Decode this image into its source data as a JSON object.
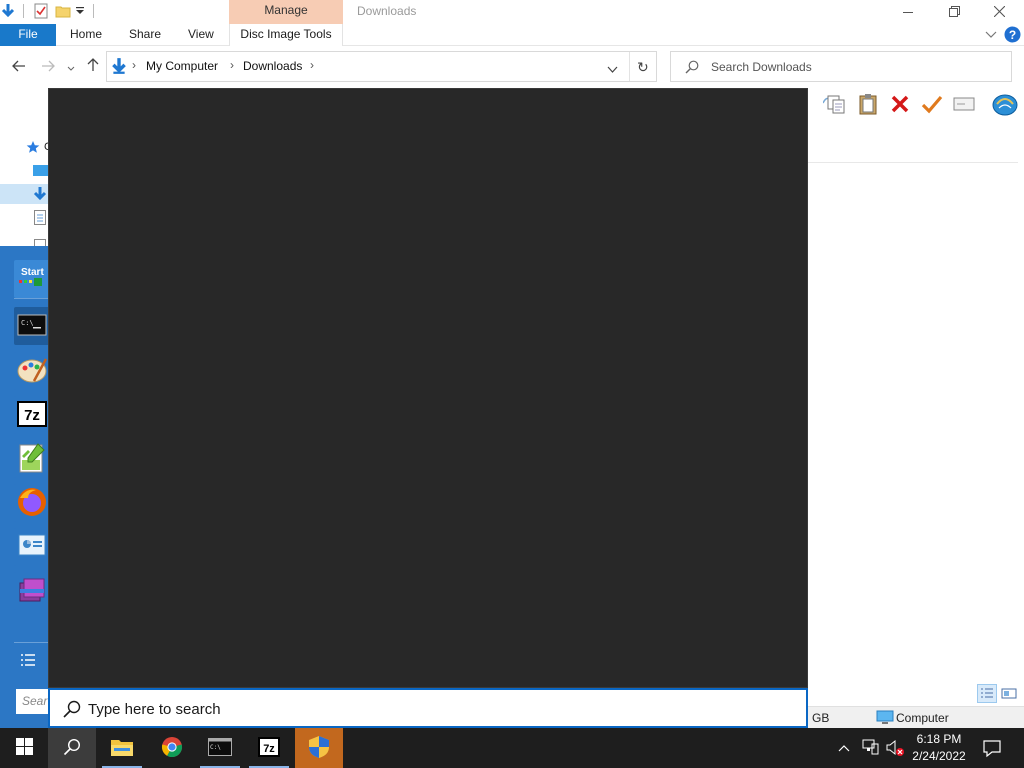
{
  "window": {
    "title": "Downloads",
    "manage_label": "Manage",
    "minimize_icon": "minimize-icon",
    "maximize_icon": "restore-icon",
    "close_icon": "close-icon"
  },
  "ribbon": {
    "tabs": [
      {
        "label": "File"
      },
      {
        "label": "Home"
      },
      {
        "label": "Share"
      },
      {
        "label": "View"
      },
      {
        "label": "Disc Image Tools"
      }
    ]
  },
  "address_bar": {
    "breadcrumbs": [
      "My Computer",
      "Downloads"
    ],
    "refresh_icon": "refresh-icon"
  },
  "search": {
    "placeholder": "Search Downloads"
  },
  "status_bar": {
    "free_space_fragment": "GB",
    "location": "Computer"
  },
  "start_menu": {
    "start_label": "Start",
    "search_placeholder": "Type here to search",
    "rail_search_fragment": "Sear",
    "tiles": [
      {
        "name": "command-prompt"
      },
      {
        "name": "paint"
      },
      {
        "name": "7-zip"
      },
      {
        "name": "notepad-plus-plus"
      },
      {
        "name": "firefox"
      },
      {
        "name": "control-panel"
      },
      {
        "name": "winrar"
      }
    ]
  },
  "taskbar": {
    "items": [
      "start",
      "search",
      "file-explorer",
      "chrome",
      "command-prompt",
      "7-zip",
      "shield"
    ],
    "time": "6:18 PM",
    "date": "2/24/2022"
  },
  "colors": {
    "accent_blue": "#1979ca",
    "manage_tab": "#f7ccb4",
    "start_panel": "#282828",
    "taskbar": "#1e1e1e",
    "rail_blue": "#2c77c5"
  }
}
